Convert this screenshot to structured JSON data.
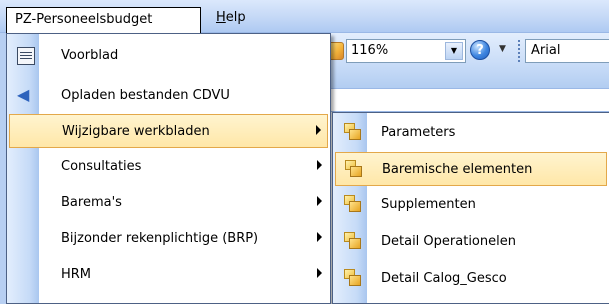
{
  "menubar": {
    "items": [
      {
        "label": "PZ-Personeelsbudget"
      },
      {
        "label": "Help",
        "accel_rest": "elp",
        "accel": "H"
      }
    ]
  },
  "toolbar": {
    "zoom_value": "116%",
    "help_symbol": "?",
    "font_value": "Arial"
  },
  "main_menu": {
    "items": [
      {
        "label": "Voorblad",
        "icon": "document-icon",
        "submenu": false
      },
      {
        "label": "Opladen bestanden CDVU",
        "icon": "back-arrow-icon",
        "submenu": false
      },
      {
        "label": "Wijzigbare werkbladen",
        "submenu": true,
        "highlighted": true
      },
      {
        "label": "Consultaties",
        "submenu": true
      },
      {
        "label": "Barema's",
        "submenu": true
      },
      {
        "label": "Bijzonder rekenplichtige (BRP)",
        "submenu": true
      },
      {
        "label": "HRM",
        "submenu": true
      }
    ]
  },
  "sub_menu": {
    "items": [
      {
        "label": "Parameters",
        "icon": "folder-icon"
      },
      {
        "label": "Baremische elementen",
        "icon": "folder-icon",
        "highlighted": true
      },
      {
        "label": "Supplementen",
        "icon": "folder-icon"
      },
      {
        "label": "Detail Operationelen",
        "icon": "folder-icon"
      },
      {
        "label": "Detail Calog_Gesco",
        "icon": "folder-icon"
      }
    ]
  },
  "colors": {
    "highlight_fill": "#ffe7a8",
    "highlight_border": "#e3a84a",
    "menubar": "#c4d8f6",
    "menu_border": "#4d6185"
  }
}
